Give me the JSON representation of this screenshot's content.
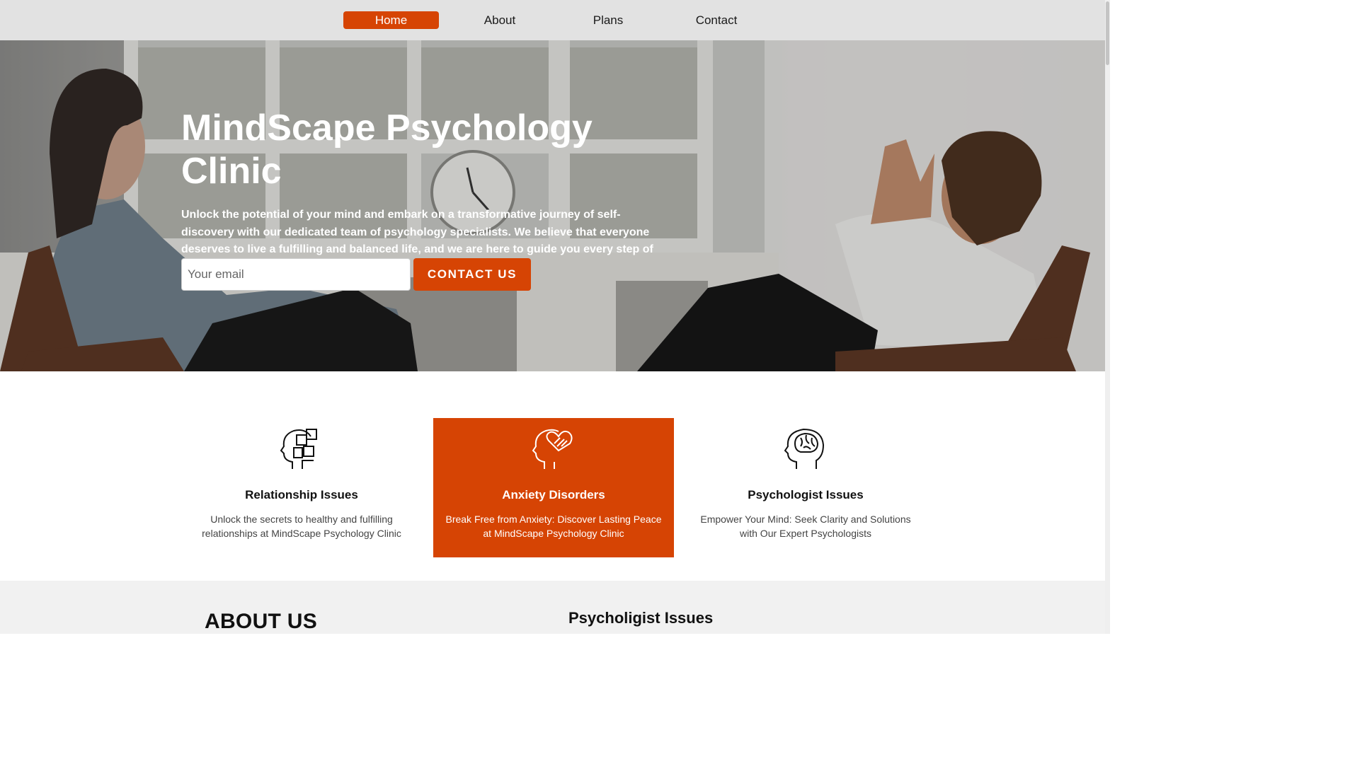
{
  "nav": {
    "items": [
      {
        "label": "Home",
        "active": true
      },
      {
        "label": "About",
        "active": false
      },
      {
        "label": "Plans",
        "active": false
      },
      {
        "label": "Contact",
        "active": false
      }
    ]
  },
  "hero": {
    "title": "MindScape Psychology Clinic",
    "text": "Unlock the potential of your mind and embark on a transformative journey of self-discovery with our dedicated team of psychology specialists. We believe that everyone deserves to live a fulfilling and balanced life, and we are here to guide you every step of the way.",
    "email_placeholder": "Your email",
    "cta_label": "CONTACT US"
  },
  "services": [
    {
      "icon": "head-puzzle-icon",
      "title": "Relationship Issues",
      "text": "Unlock the secrets to healthy and fulfilling relationships at MindScape Psychology Clinic",
      "featured": false
    },
    {
      "icon": "head-heart-icon",
      "title": "Anxiety Disorders",
      "text": "Break Free from Anxiety: Discover Lasting Peace at MindScape Psychology Clinic",
      "featured": true
    },
    {
      "icon": "head-brain-icon",
      "title": "Psychologist Issues",
      "text": "Empower Your Mind: Seek Clarity and Solutions with Our Expert Psychologists",
      "featured": false
    }
  ],
  "about": {
    "title": "ABOUT US",
    "subtitle": "Psycholigist Issues"
  },
  "colors": {
    "accent": "#d64404",
    "nav_bg": "#e2e2e2",
    "about_bg": "#f1f1f1"
  }
}
